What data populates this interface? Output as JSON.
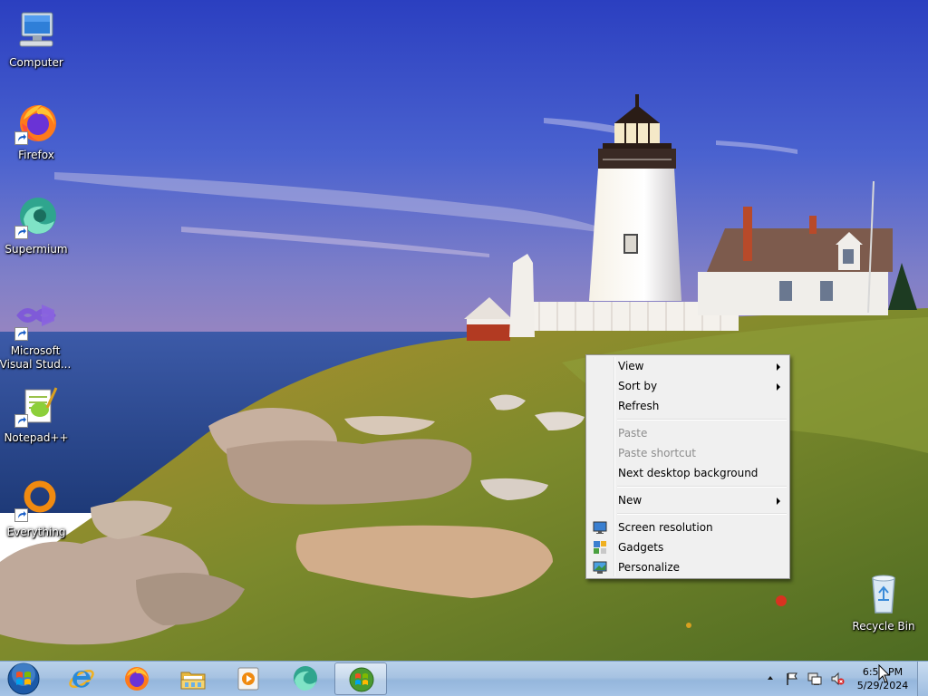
{
  "desktop": {
    "icons": [
      {
        "label": "Computer",
        "icon": "computer-icon"
      },
      {
        "label": "Firefox",
        "icon": "firefox-icon"
      },
      {
        "label": "Supermium",
        "icon": "supermium-icon"
      },
      {
        "label": "Microsoft Visual Stud...",
        "icon": "visual-studio-icon"
      },
      {
        "label": "Notepad++",
        "icon": "notepadpp-icon"
      },
      {
        "label": "Everything",
        "icon": "everything-icon"
      },
      {
        "label": "Recycle Bin",
        "icon": "recycle-bin-icon"
      }
    ]
  },
  "context_menu": {
    "view": "View",
    "sort_by": "Sort by",
    "refresh": "Refresh",
    "paste": "Paste",
    "paste_shortcut": "Paste shortcut",
    "next_background": "Next desktop background",
    "new": "New",
    "screen_resolution": "Screen resolution",
    "gadgets": "Gadgets",
    "personalize": "Personalize"
  },
  "taskbar": {
    "pinned": [
      "internet-explorer-icon",
      "firefox-icon",
      "file-explorer-icon",
      "media-player-icon",
      "supermium-icon",
      "windows-orb-icon"
    ],
    "clock": {
      "time": "6:51 PM",
      "date": "5/29/2024"
    },
    "tray_icons": [
      "show-hidden-icons-arrow",
      "action-center-flag-icon",
      "network-icon",
      "volume-muted-icon"
    ]
  },
  "colors": {
    "sky_top": "#3a57c8",
    "sea": "#2d4f9a",
    "menu_bg": "#f0f0f0",
    "taskbar": "#a7c3e2"
  }
}
